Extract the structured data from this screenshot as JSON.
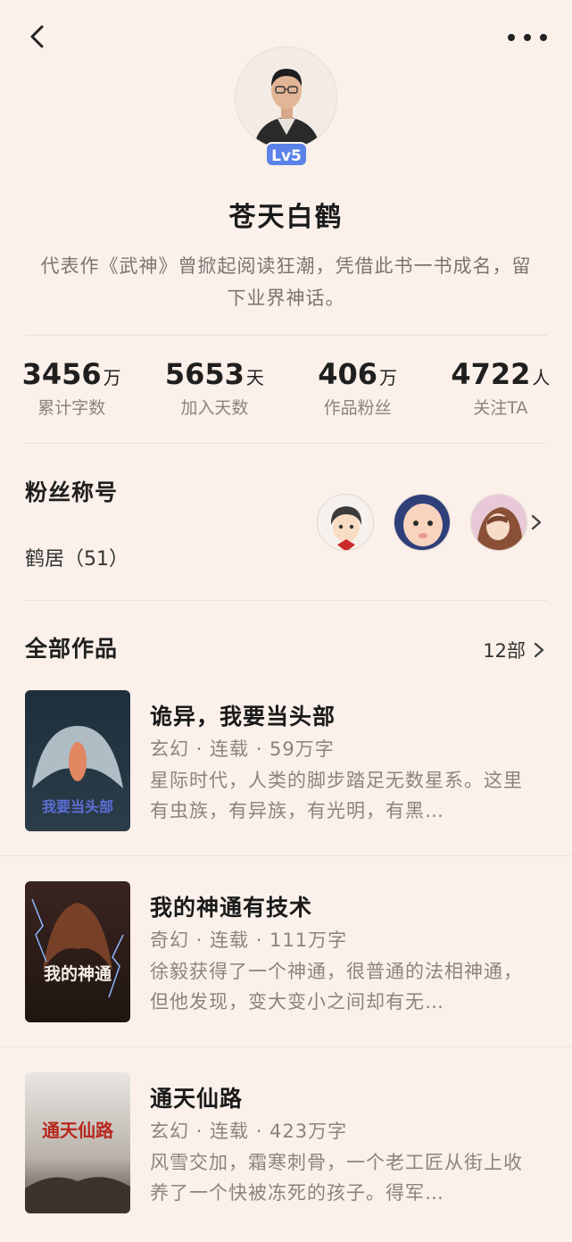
{
  "header": {
    "back_icon": "chevron-left-icon",
    "more_icon": "more-horizontal-icon"
  },
  "author": {
    "name": "苍天白鹤",
    "level": "Lv5",
    "bio": "代表作《武神》曾掀起阅读狂潮，凭借此书一书成名，留下业界神话。"
  },
  "stats": [
    {
      "value": "3456",
      "unit": "万",
      "label": "累计字数"
    },
    {
      "value": "5653",
      "unit": "天",
      "label": "加入天数"
    },
    {
      "value": "406",
      "unit": "万",
      "label": "作品粉丝"
    },
    {
      "value": "4722",
      "unit": "人",
      "label": "关注TA"
    }
  ],
  "fan_section": {
    "title": "粉丝称号",
    "value": "鹤居（51）"
  },
  "works_section": {
    "title": "全部作品",
    "count": "12部"
  },
  "books": [
    {
      "title": "诡异，我要当头部",
      "meta": "玄幻 · 连载 · 59万字",
      "desc": "星际时代，人类的脚步踏足无数星系。这里有虫族，有异族，有光明，有黑…",
      "cover_text": "我要当头部"
    },
    {
      "title": "我的神通有技术",
      "meta": "奇幻 · 连载 · 111万字",
      "desc": "徐毅获得了一个神通，很普通的法相神通，但他发现，变大变小之间却有无…",
      "cover_text": "我的神通"
    },
    {
      "title": "通天仙路",
      "meta": "玄幻 · 连载 · 423万字",
      "desc": "风雪交加，霜寒刺骨，一个老工匠从街上收养了一个快被冻死的孩子。得军…",
      "cover_text": "通天仙路"
    }
  ],
  "colors": {
    "background": "#fbf1ea",
    "level_badge": "#5b82e8",
    "muted_text": "#8a8480"
  }
}
